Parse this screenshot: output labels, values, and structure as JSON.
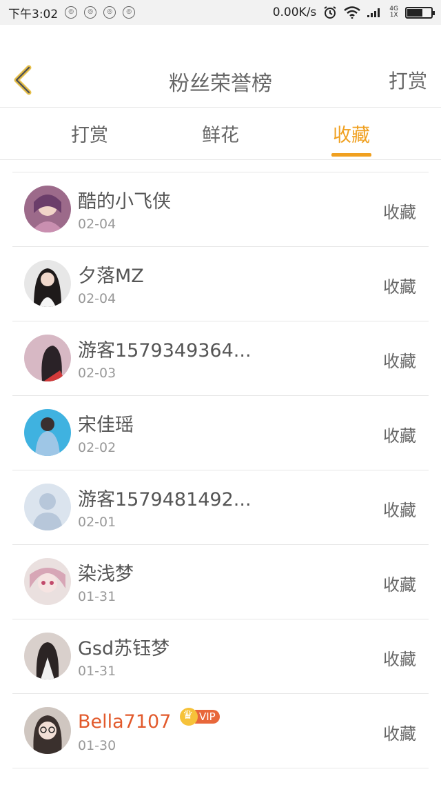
{
  "status_bar": {
    "time": "下午3:02",
    "speed": "0.00K/s",
    "network_top": "4G",
    "network_bottom": "1X"
  },
  "header": {
    "title": "粉丝荣誉榜",
    "right_action": "打赏",
    "back_icon": "chevron-left-icon",
    "accent_color": "#f0a020"
  },
  "tabs": [
    {
      "label": "打赏",
      "active": false
    },
    {
      "label": "鲜花",
      "active": false
    },
    {
      "label": "收藏",
      "active": true
    }
  ],
  "fans": [
    {
      "name": "酷的小飞侠",
      "date": "02-04",
      "action": "收藏"
    },
    {
      "name": "夕落MZ",
      "date": "02-04",
      "action": "收藏"
    },
    {
      "name": "游客1579349364...",
      "date": "02-03",
      "action": "收藏"
    },
    {
      "name": "宋佳瑶",
      "date": "02-02",
      "action": "收藏"
    },
    {
      "name": "游客1579481492...",
      "date": "02-01",
      "action": "收藏"
    },
    {
      "name": "染浅梦",
      "date": "01-31",
      "action": "收藏"
    },
    {
      "name": "Gsd苏钰梦",
      "date": "01-31",
      "action": "收藏"
    },
    {
      "name": "Bella7107",
      "date": "01-30",
      "action": "收藏",
      "vip": "VIP"
    }
  ]
}
